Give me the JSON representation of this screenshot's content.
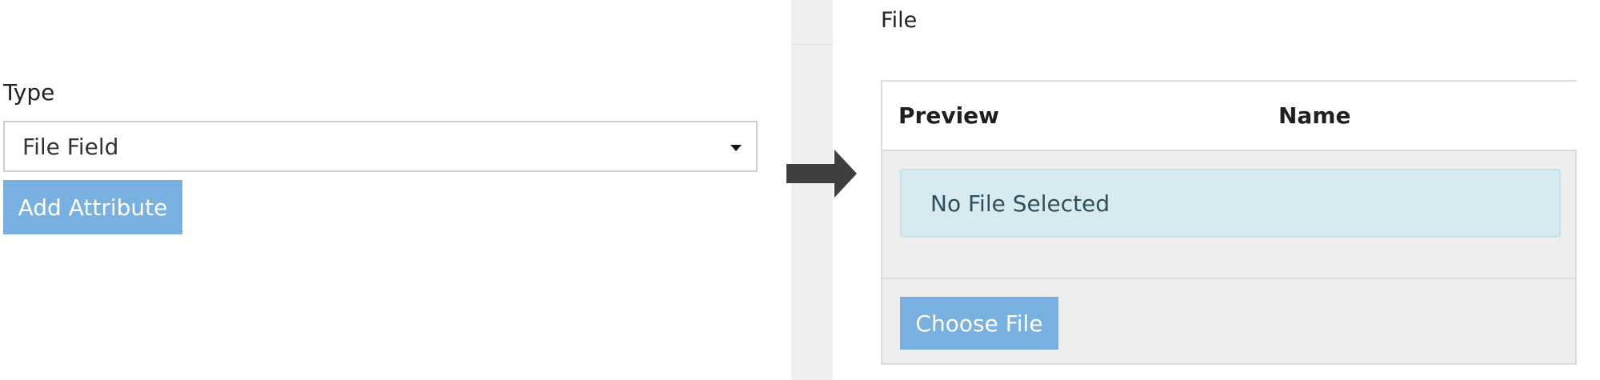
{
  "left_panel": {
    "type_label": "Type",
    "type_select": {
      "selected_value": "File Field"
    },
    "add_attribute_label": "Add Attribute"
  },
  "arrow": {
    "icon": "right-arrow-icon"
  },
  "right_panel": {
    "file_label": "File",
    "table": {
      "columns": [
        "Preview",
        "Name"
      ]
    },
    "empty_message": "No File Selected",
    "choose_file_label": "Choose File"
  },
  "colors": {
    "button_bg": "#78b1df",
    "alert_bg": "#d6eaef",
    "arrow": "#3f3f3f",
    "panel_bg": "#eeeeee"
  }
}
